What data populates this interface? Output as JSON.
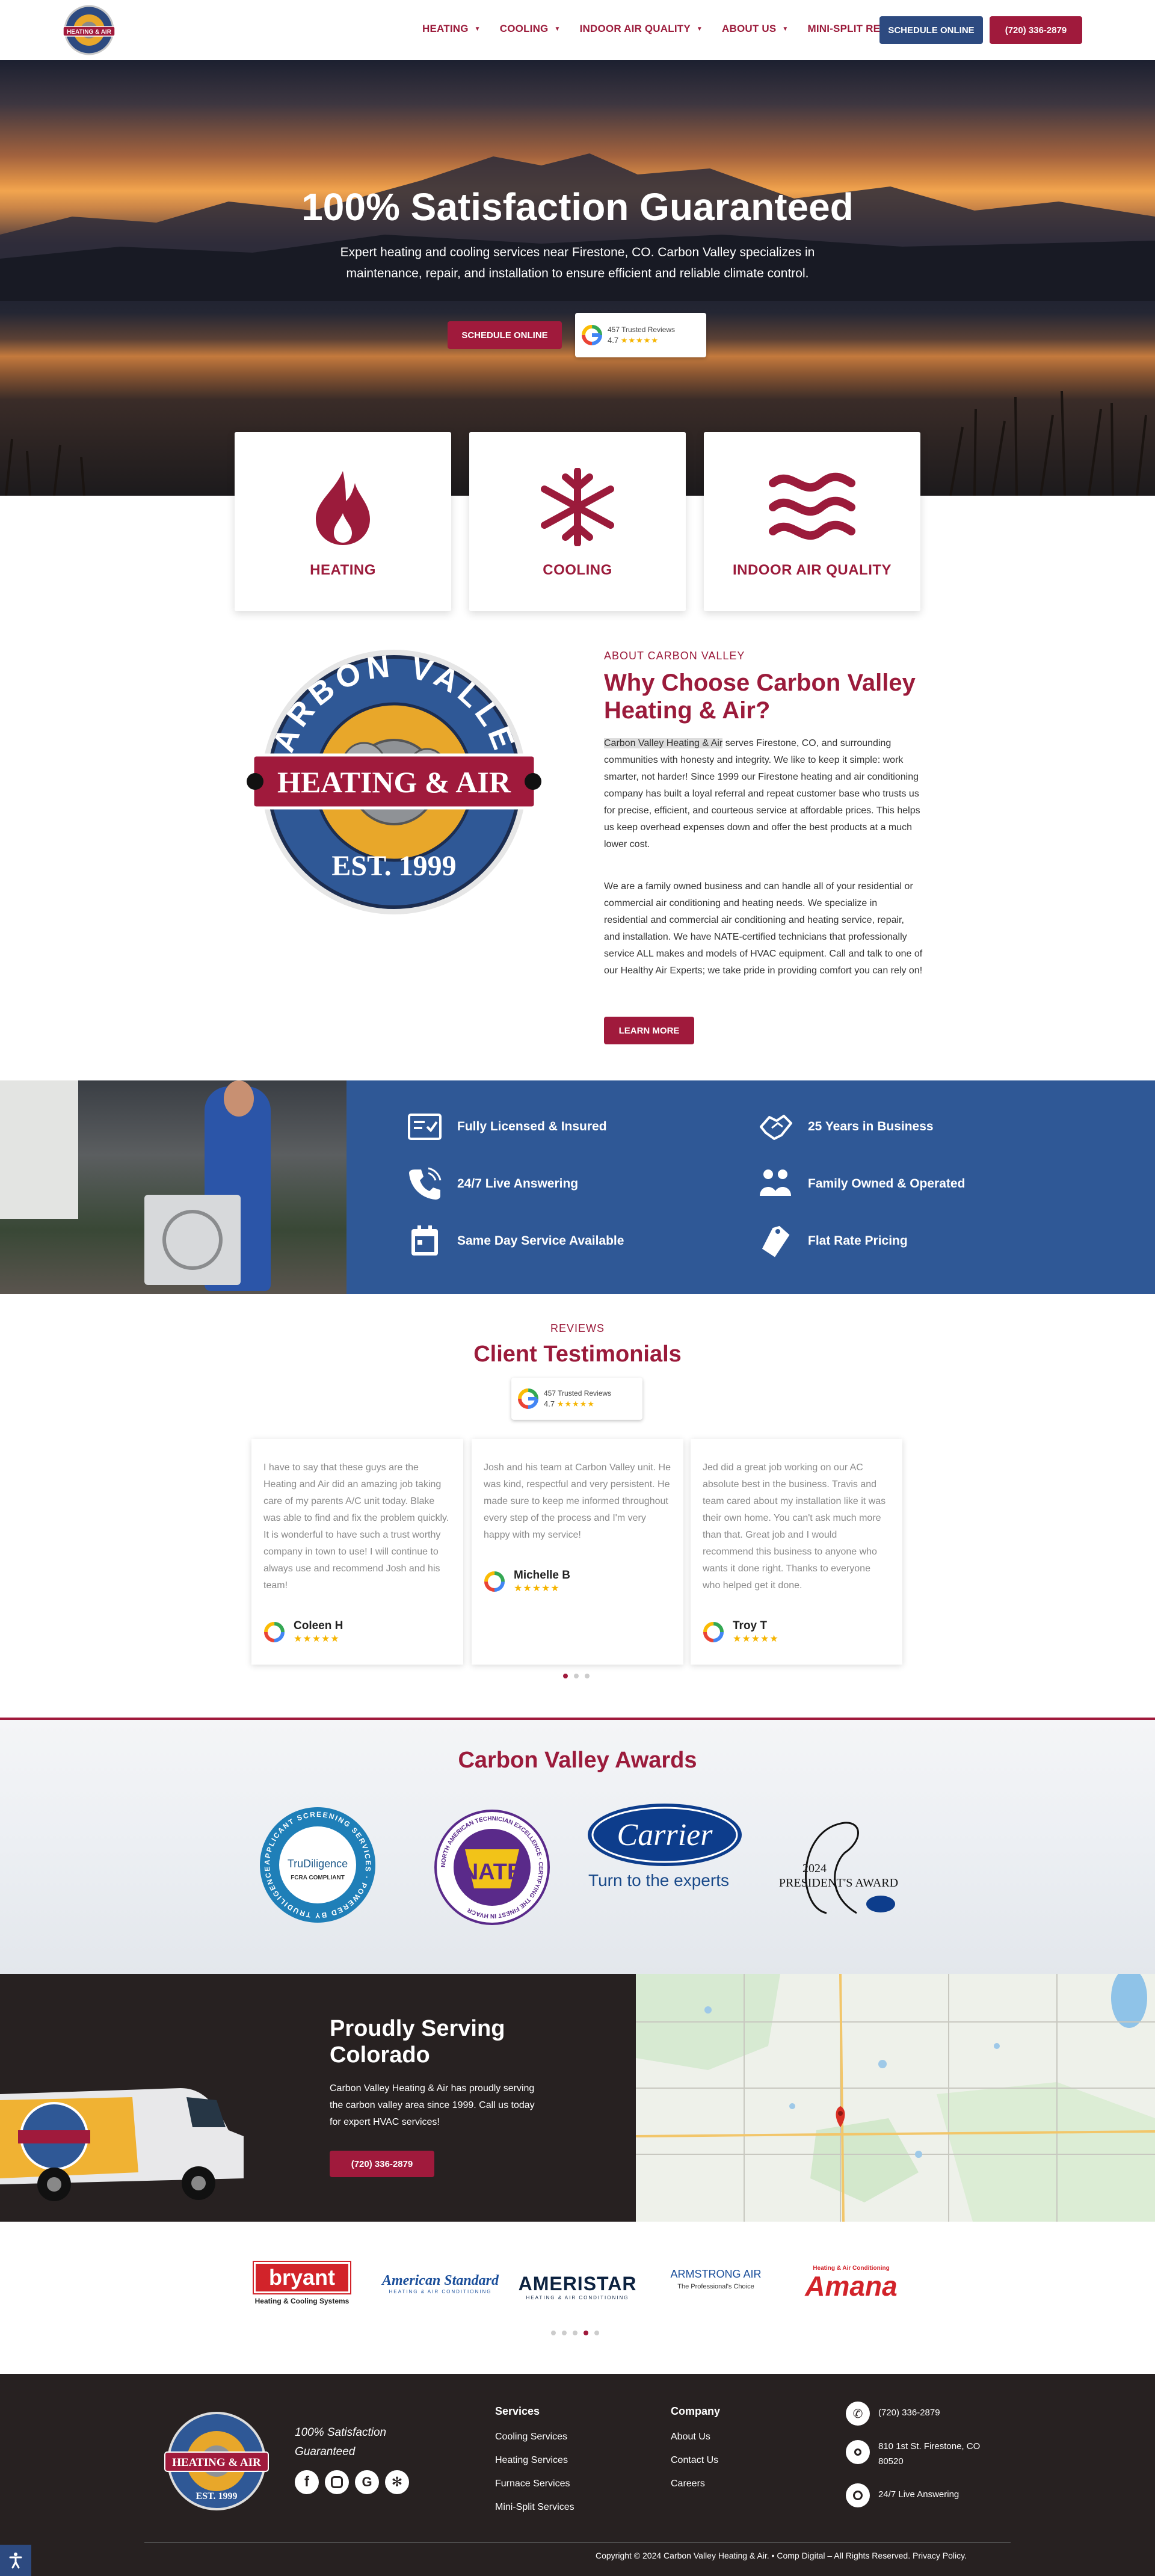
{
  "header": {
    "logo_alt": "Carbon Valley Heating & Air",
    "nav": [
      {
        "label": "HEATING"
      },
      {
        "label": "COOLING"
      },
      {
        "label": "INDOOR AIR QUALITY"
      },
      {
        "label": "ABOUT US"
      },
      {
        "label": "MINI-SPLIT REPAIR"
      }
    ],
    "schedule_label": "SCHEDULE ONLINE",
    "phone_label": "(720) 336-2879"
  },
  "hero": {
    "title": "100% Satisfaction Guaranteed",
    "subtitle": "Expert heating and cooling services near Firestone, CO. Carbon Valley specializes in maintenance, repair, and installation to ensure efficient and reliable climate control.",
    "cta": "SCHEDULE ONLINE",
    "reviews_text": "457 Trusted Reviews",
    "rating": "4.7",
    "stars": "★★★★★"
  },
  "services": [
    {
      "label": "HEATING",
      "icon": "flame-icon"
    },
    {
      "label": "COOLING",
      "icon": "snowflake-icon"
    },
    {
      "label": "INDOOR AIR QUALITY",
      "icon": "air-waves-icon"
    }
  ],
  "about": {
    "kicker": "ABOUT CARBON VALLEY",
    "title": "Why Choose Carbon Valley Heating & Air?",
    "highlight": "Carbon Valley Heating & Air",
    "p1_rest": " serves Firestone, CO, and surrounding communities with honesty and integrity. We like to keep it simple: work smarter, not harder! Since 1999 our Firestone heating and air conditioning company has built a loyal referral and repeat customer base who trusts us for precise, efficient, and courteous service at affordable prices. This helps us keep overhead expenses down and offer the best products at a much lower cost.",
    "p2": "We are a family owned business and can handle all of your residential or commercial air conditioning and heating needs. We specialize in residential and commercial air conditioning and heating service, repair, and installation. We have NATE-certified technicians that professionally service ALL makes and models of HVAC equipment. Call and talk to one of our Healthy Air Experts; we take pride in providing comfort you can rely on!",
    "cta": "LEARN MORE",
    "seal_top": "CARBON VALLEY",
    "seal_mid": "HEATING & AIR",
    "seal_bottom": "EST. 1999"
  },
  "features": [
    {
      "label": "Fully Licensed & Insured",
      "icon": "license-icon"
    },
    {
      "label": "25 Years in Business",
      "icon": "handshake-icon"
    },
    {
      "label": "24/7 Live Answering",
      "icon": "phone-icon"
    },
    {
      "label": "Family Owned & Operated",
      "icon": "family-icon"
    },
    {
      "label": "Same Day Service Available",
      "icon": "calendar-icon"
    },
    {
      "label": "Flat Rate Pricing",
      "icon": "price-tag-icon"
    }
  ],
  "reviews": {
    "kicker": "REVIEWS",
    "title": "Client Testimonials",
    "badge_text": "457 Trusted Reviews",
    "badge_rating": "4.7",
    "stars": "★★★★★",
    "items": [
      {
        "text": "I have to say that these guys are the Heating and Air did an amazing job taking care of my parents A/C unit today. Blake was able to find and fix the problem quickly. It is wonderful to have such a trust worthy company in town to use! I will continue to always use and recommend Josh and his team!",
        "name": "Coleen H"
      },
      {
        "text": "Josh and his team at Carbon Valley unit. He was kind, respectful and very persistent. He made sure to keep me informed throughout every step of the process and I'm very happy with my service!",
        "name": "Michelle B"
      },
      {
        "text": "Jed did a great job working on our AC absolute best in the business. Travis and team cared about my installation like it was their own home. You can't ask much more than that. Great job and I would recommend this business to anyone who wants it done right. Thanks to everyone who helped get it done.",
        "name": "Troy T"
      }
    ]
  },
  "awards": {
    "title": "Carbon Valley Awards",
    "items": [
      {
        "name": "TruDiligence",
        "ring": "APPLICANT SCREENING SERVICES · POWERED BY TRUDILIGENCE",
        "sub": "FCRA COMPLIANT"
      },
      {
        "name": "NATE",
        "ring": "NORTH AMERICAN TECHNICIAN EXCELLENCE · CERTIFYING THE FINEST IN HVACR"
      },
      {
        "name": "Carrier",
        "sub": "Turn to the experts"
      },
      {
        "name": "PRESIDENT'S AWARD",
        "year": "2024"
      }
    ]
  },
  "serving": {
    "title": "Proudly Serving Colorado",
    "text": "Carbon Valley Heating & Air has proudly serving the carbon valley area since 1999. Call us today for expert HVAC services!",
    "cta": "(720) 336-2879"
  },
  "brands": [
    {
      "name": "bryant",
      "sub": "Heating & Cooling Systems"
    },
    {
      "name": "American Standard",
      "sub": "HEATING & AIR CONDITIONING"
    },
    {
      "name": "AMERISTAR",
      "sub": "HEATING & AIR CONDITIONING"
    },
    {
      "name": "ARMSTRONG AIR",
      "sub": "The Professional's Choice"
    },
    {
      "name": "Amana",
      "sub": "Heating & Air Conditioning"
    }
  ],
  "footer": {
    "tagline": "100% Satisfaction Guaranteed",
    "services_title": "Services",
    "services": [
      "Cooling Services",
      "Heating Services",
      "Furnace Services",
      "Mini-Split Services"
    ],
    "company_title": "Company",
    "company": [
      "About Us",
      "Contact Us",
      "Careers"
    ],
    "phone": "(720) 336-2879",
    "address": "810 1st St. Firestone, CO 80520",
    "hours": "24/7 Live Answering",
    "copyright": "Copyright © 2024 Carbon Valley Heating & Air. • Comp Digital – All Rights Reserved. Privacy Policy."
  },
  "colors": {
    "brand_red": "#a01a3c",
    "brand_blue": "#2f5896",
    "dark": "#272121"
  }
}
